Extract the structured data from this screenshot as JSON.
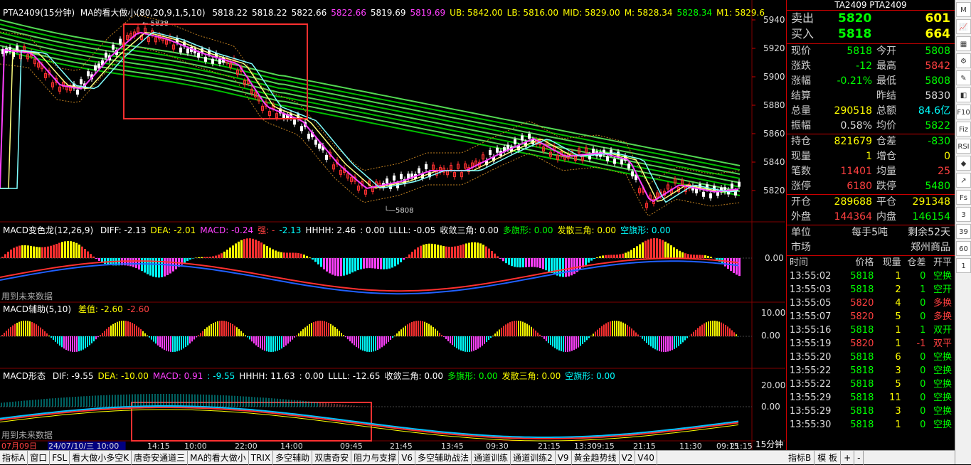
{
  "main_title": {
    "symbol": "PTA2409(15分钟)",
    "indicator": "MA的看大做小(80,20,9,1,5,10)",
    "values": [
      {
        "t": "5818.22",
        "c": "#ffffff"
      },
      {
        "t": "5818.22",
        "c": "#ffffff"
      },
      {
        "t": "5822.66",
        "c": "#ffffff"
      },
      {
        "t": "5822.66",
        "c": "#ff40ff"
      },
      {
        "t": "5819.69",
        "c": "#ffffff"
      },
      {
        "t": "5819.69",
        "c": "#ff40ff"
      },
      {
        "t": "UB: 5842.00",
        "c": "#ffff00"
      },
      {
        "t": "LB: 5816.00",
        "c": "#ffff00"
      },
      {
        "t": "MID: 5829.00",
        "c": "#ffff00"
      },
      {
        "t": "M: 5828.34",
        "c": "#ffff00"
      },
      {
        "t": "5828.34",
        "c": "#00ff00"
      },
      {
        "t": "M1: 5829.6",
        "c": "#ffff00"
      }
    ]
  },
  "price_axis": [
    "5940",
    "5920",
    "5900",
    "5880",
    "5860",
    "5840",
    "5820"
  ],
  "price_marks": {
    "high": "5838",
    "low": "5808"
  },
  "macd1": {
    "title": "MACD变色龙(12,26,9)",
    "items": [
      {
        "t": "DIFF: -2.13",
        "c": "#ffffff"
      },
      {
        "t": "DEA: -2.01",
        "c": "#ffff00"
      },
      {
        "t": "MACD: -0.24",
        "c": "#ff40ff"
      },
      {
        "t": "强: -",
        "c": "#ff4040"
      },
      {
        "t": "-2.13",
        "c": "#00ffff"
      },
      {
        "t": "HHHH: 2.46",
        "c": "#ffffff"
      },
      {
        "t": ": 0.00",
        "c": "#ffffff"
      },
      {
        "t": "LLLL: -0.05",
        "c": "#ffffff"
      },
      {
        "t": "收敛三角: 0.00",
        "c": "#ffffff"
      },
      {
        "t": "多旗形: 0.00",
        "c": "#00ff00"
      },
      {
        "t": "发散三角: 0.00",
        "c": "#ffff00"
      },
      {
        "t": "空旗形: 0.00",
        "c": "#00ffff"
      }
    ],
    "axis": [
      "0.00"
    ],
    "note": "用到未来数据"
  },
  "macd2": {
    "title": "MACD辅助(5,10)",
    "items": [
      {
        "t": "差值: -2.60",
        "c": "#ffff00"
      },
      {
        "t": "-2.60",
        "c": "#ff4040"
      }
    ],
    "axis": [
      "10.00",
      "0.00"
    ]
  },
  "macd3": {
    "title": "MACD形态",
    "items": [
      {
        "t": "DIF: -9.55",
        "c": "#ffffff"
      },
      {
        "t": "DEA: -10.00",
        "c": "#ffff00"
      },
      {
        "t": "MACD: 0.91",
        "c": "#ff40ff"
      },
      {
        "t": ": -9.55",
        "c": "#00ffff"
      },
      {
        "t": "HHHH: 11.63",
        "c": "#ffffff"
      },
      {
        "t": ": 0.00",
        "c": "#ffffff"
      },
      {
        "t": "LLLL: -12.65",
        "c": "#ffffff"
      },
      {
        "t": "收敛三角: 0.00",
        "c": "#ffffff"
      },
      {
        "t": "多旗形: 0.00",
        "c": "#00ff00"
      },
      {
        "t": "发散三角: 0.00",
        "c": "#ffff00"
      },
      {
        "t": "空旗形: 0.00",
        "c": "#00ffff"
      }
    ],
    "axis": [
      "20.00",
      "0.00"
    ],
    "note": "用到未来数据"
  },
  "time_axis": [
    "07月09日",
    "24/07/10/三 10:00",
    "14:15",
    "10:00",
    "22:00",
    "14:00",
    "09:45",
    "21:45",
    "13:45",
    "09:30",
    "21:15",
    "13:30",
    "09:15",
    "21:15",
    "11:30",
    "09:15",
    "21:15",
    "11:15"
  ],
  "period_label": "15分钟",
  "quote": {
    "header": "TA2409 PTA2409",
    "sell": {
      "label": "卖出",
      "price": "5820",
      "vol": "601"
    },
    "buy": {
      "label": "买入",
      "price": "5818",
      "vol": "664"
    },
    "rows": [
      {
        "l1": "现价",
        "v1": "5818",
        "c1": "g",
        "l2": "今开",
        "v2": "5808",
        "c2": "g"
      },
      {
        "l1": "涨跌",
        "v1": "-12",
        "c1": "g",
        "l2": "最高",
        "v2": "5842",
        "c2": "r"
      },
      {
        "l1": "涨幅",
        "v1": "-0.21%",
        "c1": "g",
        "l2": "最低",
        "v2": "5808",
        "c2": "g"
      },
      {
        "l1": "结算",
        "v1": "",
        "c1": "w",
        "l2": "昨结",
        "v2": "5830",
        "c2": "w"
      },
      {
        "l1": "总量",
        "v1": "290518",
        "c1": "y",
        "l2": "总额",
        "v2": "84.6亿",
        "c2": "c"
      },
      {
        "l1": "振幅",
        "v1": "0.58%",
        "c1": "w",
        "l2": "均价",
        "v2": "5822",
        "c2": "g"
      }
    ],
    "rows2": [
      {
        "l1": "持仓",
        "v1": "821679",
        "c1": "y",
        "l2": "仓差",
        "v2": "-830",
        "c2": "g"
      },
      {
        "l1": "现量",
        "v1": "1",
        "c1": "y",
        "l2": "增仓",
        "v2": "0",
        "c2": "y"
      },
      {
        "l1": "笔数",
        "v1": "11401",
        "c1": "r",
        "l2": "均量",
        "v2": "25",
        "c2": "r"
      },
      {
        "l1": "涨停",
        "v1": "6180",
        "c1": "r",
        "l2": "跌停",
        "v2": "5480",
        "c2": "g"
      }
    ],
    "rows3": [
      {
        "l1": "开仓",
        "v1": "289688",
        "c1": "y",
        "l2": "平仓",
        "v2": "291348",
        "c2": "y"
      },
      {
        "l1": "外盘",
        "v1": "144364",
        "c1": "r",
        "l2": "内盘",
        "v2": "146154",
        "c2": "g"
      }
    ],
    "unit": {
      "l1": "单位",
      "v1": "每手5吨",
      "l2": "剩余52天"
    },
    "market": {
      "l1": "市场",
      "v1": "郑州商品"
    }
  },
  "ticks": {
    "headers": [
      "时间",
      "价格",
      "现量",
      "仓差",
      "开平"
    ],
    "rows": [
      {
        "time": "13:55:02",
        "price": "5818",
        "vol": "1",
        "diff": "0",
        "type": "空换",
        "tc": "g"
      },
      {
        "time": "13:55:03",
        "price": "5818",
        "vol": "2",
        "diff": "1",
        "type": "空开",
        "tc": "g"
      },
      {
        "time": "13:55:05",
        "price": "5820",
        "vol": "4",
        "diff": "0",
        "type": "多换",
        "tc": "r"
      },
      {
        "time": "13:55:07",
        "price": "5820",
        "vol": "5",
        "diff": "0",
        "type": "多换",
        "tc": "r"
      },
      {
        "time": "13:55:16",
        "price": "5818",
        "vol": "1",
        "diff": "1",
        "type": "双开",
        "tc": "g"
      },
      {
        "time": "13:55:19",
        "price": "5820",
        "vol": "1",
        "diff": "-1",
        "type": "双平",
        "tc": "r"
      },
      {
        "time": "13:55:20",
        "price": "5818",
        "vol": "6",
        "diff": "0",
        "type": "空换",
        "tc": "g"
      },
      {
        "time": "13:55:22",
        "price": "5818",
        "vol": "3",
        "diff": "0",
        "type": "空换",
        "tc": "g"
      },
      {
        "time": "13:55:22",
        "price": "5818",
        "vol": "5",
        "diff": "0",
        "type": "空换",
        "tc": "g"
      },
      {
        "time": "13:55:29",
        "price": "5818",
        "vol": "11",
        "diff": "0",
        "type": "空换",
        "tc": "g"
      },
      {
        "time": "13:55:29",
        "price": "5818",
        "vol": "3",
        "diff": "0",
        "type": "空换",
        "tc": "g"
      },
      {
        "time": "13:55:30",
        "price": "5818",
        "vol": "1",
        "diff": "0",
        "type": "空换",
        "tc": "g"
      }
    ]
  },
  "bottom_tabs": [
    "指标A",
    "窗口",
    "FSL",
    "看大做小多空K",
    "唐奇安通道三",
    "MA的看大做小",
    "TRIX",
    "多空辅助",
    "双唐奇安",
    "阻力与支撑",
    "V6",
    "多空辅助战法",
    "通道训练",
    "通道训练2",
    "V9",
    "黄金趋势线",
    "V2",
    "V40"
  ],
  "bottom_right_tabs": [
    "指标B",
    "模 板",
    "+",
    "-"
  ],
  "tools": [
    "M",
    "📈",
    "▦",
    "⚙",
    "✎",
    "◧",
    "F10",
    "Fiz",
    "RSI",
    "◆",
    "↗",
    "Fs",
    "3",
    "39",
    "60",
    "1"
  ]
}
